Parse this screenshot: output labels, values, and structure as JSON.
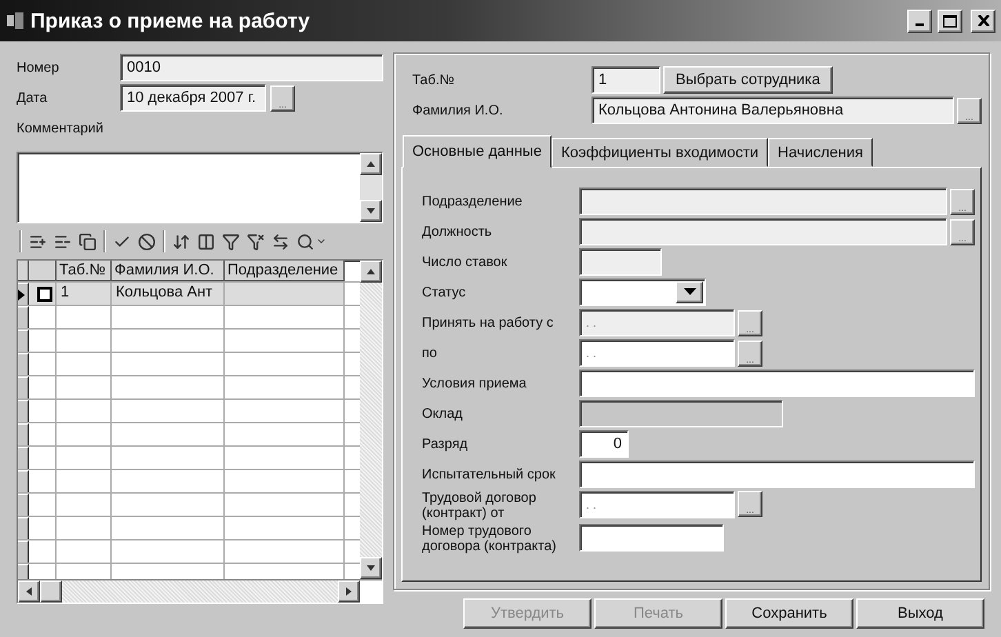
{
  "window": {
    "title": "Приказ о приеме на работу"
  },
  "header": {
    "fields": [
      {
        "label": "Номер",
        "value": "0010",
        "kind": "text"
      },
      {
        "label": "Дата",
        "value": "10 декабря 2007 г.",
        "kind": "date",
        "button": "..."
      }
    ],
    "comment_label": "Комментарий"
  },
  "grid": {
    "columns": [
      "Таб.№",
      "Фамилия И.О.",
      "Подразделение"
    ],
    "rows": [
      {
        "tab_no": "1",
        "name": "Кольцова Ант",
        "current": true,
        "checked": false
      }
    ]
  },
  "employee": {
    "tab_label": "Таб.№",
    "tab_value": "1",
    "select_button": "Выбрать сотрудника",
    "name_label": "Фамилия И.О.",
    "name_value": "Кольцова Антонина Валерьяновна",
    "name_button": "..."
  },
  "tabs": [
    {
      "label": "Основные данные",
      "selected": true
    },
    {
      "label": "Коэффициенты входимости",
      "selected": false
    },
    {
      "label": "Начисления",
      "selected": false
    }
  ],
  "form": [
    {
      "label": "Подразделение",
      "kind": "lookup",
      "disabled": false,
      "button": "..."
    },
    {
      "label": "Должность",
      "kind": "lookup",
      "disabled": false,
      "button": "..."
    },
    {
      "label": "Число ставок",
      "kind": "short",
      "disabled": false
    },
    {
      "label": "Статус",
      "kind": "combo",
      "disabled": false
    },
    {
      "label": "Принять на работу с",
      "kind": "date",
      "placeholder": ". .",
      "disabled": false,
      "button": "..."
    },
    {
      "label": "по",
      "kind": "date",
      "placeholder": ". .",
      "disabled": false,
      "button": "..."
    },
    {
      "label": "Условия приема",
      "kind": "wide",
      "disabled": false
    },
    {
      "label": "Оклад",
      "kind": "medium",
      "disabled": true
    },
    {
      "label": "Разряд",
      "kind": "number",
      "value": "0",
      "disabled": false
    },
    {
      "label": "Испытательный срок",
      "kind": "wide",
      "disabled": false
    },
    {
      "label": "Трудовой договор (контракт) от",
      "kind": "date",
      "placeholder": ". .",
      "disabled": false,
      "button": "..."
    },
    {
      "label": "Номер трудового договора (контракта)",
      "kind": "medium2",
      "disabled": false
    }
  ],
  "buttons": [
    {
      "label": "Утвердить",
      "disabled": true
    },
    {
      "label": "Печать",
      "disabled": true
    },
    {
      "label": "Сохранить",
      "disabled": false
    },
    {
      "label": "Выход",
      "disabled": false
    }
  ]
}
